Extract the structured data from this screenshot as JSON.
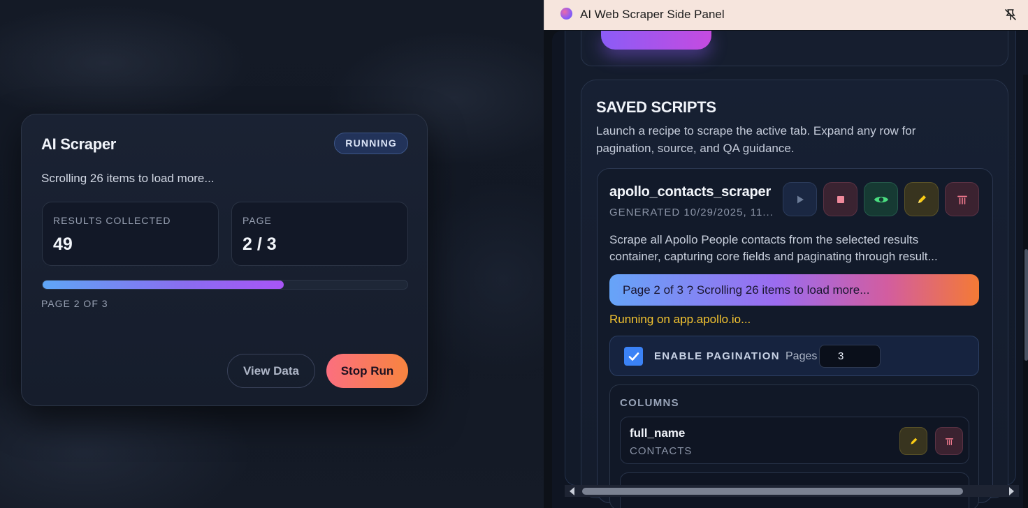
{
  "scraper_card": {
    "title": "AI Scraper",
    "badge": "RUNNING",
    "status": "Scrolling 26 items to load more...",
    "stats": [
      {
        "label": "RESULTS COLLECTED",
        "value": "49"
      },
      {
        "label": "PAGE",
        "value": "2 / 3"
      }
    ],
    "progress_fraction": 0.66,
    "progress_label": "PAGE 2 OF 3",
    "view_button": "View Data",
    "stop_button": "Stop Run"
  },
  "side_panel": {
    "title": "AI Web Scraper Side Panel",
    "pin_icon": "unpin-icon"
  },
  "saved_scripts": {
    "title": "SAVED SCRIPTS",
    "description": "Launch a recipe to scrape the active tab. Expand any row for pagination, source, and QA guidance.",
    "script": {
      "name": "apollo_contacts_scraper",
      "meta": "GENERATED 10/29/2025, 11...",
      "actions": [
        "play-icon",
        "stop-icon",
        "eye-icon",
        "pencil-icon",
        "trash-icon"
      ],
      "description": "Scrape all Apollo People contacts from the selected results container, capturing core fields and paginating through result...",
      "run_banner": "Page 2 of 3 ? Scrolling 26 items to load more...",
      "running_on": "Running on app.apollo.io...",
      "pagination": {
        "label": "ENABLE PAGINATION",
        "checked": true,
        "pages_label": "Pages",
        "pages_value": "3"
      },
      "columns": {
        "title": "COLUMNS",
        "items": [
          {
            "name": "full_name",
            "source": "CONTACTS"
          }
        ]
      }
    }
  },
  "colors": {
    "accent_blue": "#3b82f6",
    "running_text": "#f4c430",
    "stop_gradient_start": "#fb6f7f",
    "stop_gradient_end": "#f7843f"
  }
}
